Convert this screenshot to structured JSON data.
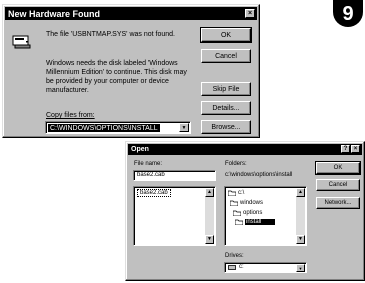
{
  "step_number": "9",
  "hardware_dialog": {
    "title": "New Hardware Found",
    "message_not_found": "The file 'USBNTMAP.SYS' was not found.",
    "message_insert_lines": [
      "Windows needs the disk labeled 'Windows",
      "Millennium Edition' to continue. This disk may",
      "be provided by your computer or device",
      "manufacturer."
    ],
    "copy_from_label": "Copy files from:",
    "copy_from_value": "C:\\WINDOWS\\OPTIONS\\INSTALL",
    "buttons": {
      "ok": "OK",
      "cancel": "Cancel",
      "skip_file": "Skip File",
      "details": "Details...",
      "browse": "Browse..."
    }
  },
  "open_dialog": {
    "title": "Open",
    "file_name_label": "File name:",
    "file_name_value": "base2.cab",
    "file_list": [
      "base2.cab"
    ],
    "folders_label": "Folders:",
    "current_folder": "c:\\windows\\options\\install",
    "folder_tree": [
      {
        "name": "c:\\",
        "selected": false
      },
      {
        "name": "windows",
        "selected": false
      },
      {
        "name": "options",
        "selected": false
      },
      {
        "name": "install",
        "selected": true
      }
    ],
    "drives_label": "Drives:",
    "drives_value": "c:",
    "buttons": {
      "ok": "OK",
      "cancel": "Cancel",
      "network": "Network..."
    },
    "title_buttons": {
      "help": "?",
      "close": "x"
    }
  },
  "colors": {
    "dialog_face": "#c0c0c0",
    "title_bar": "#000000",
    "selection": "#000000"
  }
}
